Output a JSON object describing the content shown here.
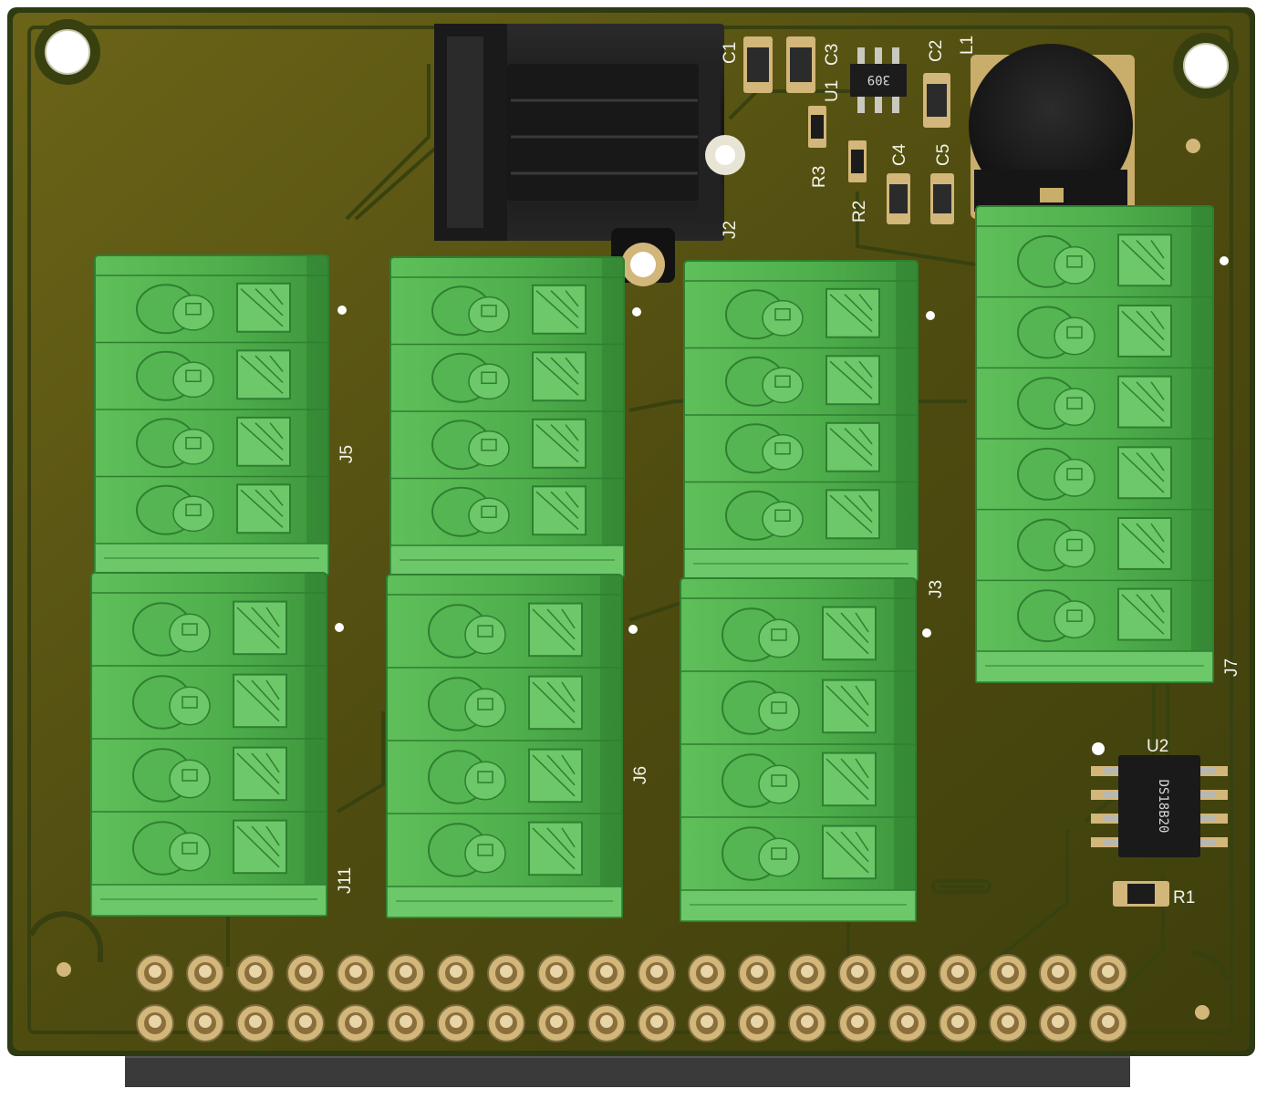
{
  "board": {
    "colors": {
      "background": "#ffffff",
      "pcb_edge": "#2e3a12",
      "pcb_base": "#4a4a0e",
      "pcb_highlight": "#6b6418",
      "trace": "#38420f",
      "silkscreen": "#f4f4ee",
      "copper_pad": "#d2b67a",
      "terminal_green": "#55b552",
      "terminal_light": "#6cc868",
      "terminal_dark": "#2f7f30",
      "component_black": "#1c1c1c"
    },
    "labels": {
      "c1": "C1",
      "c2": "C2",
      "c3": "C3",
      "c4": "C4",
      "c5": "C5",
      "u1": "U1",
      "u1_mark": "309",
      "r1": "R1",
      "r2": "R2",
      "r3": "R3",
      "l1": "L1",
      "j2": "J2",
      "j3": "J3",
      "j5": "J5",
      "j6": "J6",
      "j7": "J7",
      "j11": "J11",
      "u2": "U2",
      "u2_mark": "DS18B20"
    },
    "terminal_blocks": [
      {
        "ref": "J5",
        "pins": 4
      },
      {
        "ref": "J11",
        "pins": 4
      },
      {
        "ref": "J6",
        "pins": 4
      },
      {
        "ref": "J6b",
        "pins": 4
      },
      {
        "ref": "J3a",
        "pins": 4
      },
      {
        "ref": "J3",
        "pins": 4
      },
      {
        "ref": "J7",
        "pins": 6
      }
    ],
    "header": {
      "rows": 2,
      "columns": 20
    }
  }
}
